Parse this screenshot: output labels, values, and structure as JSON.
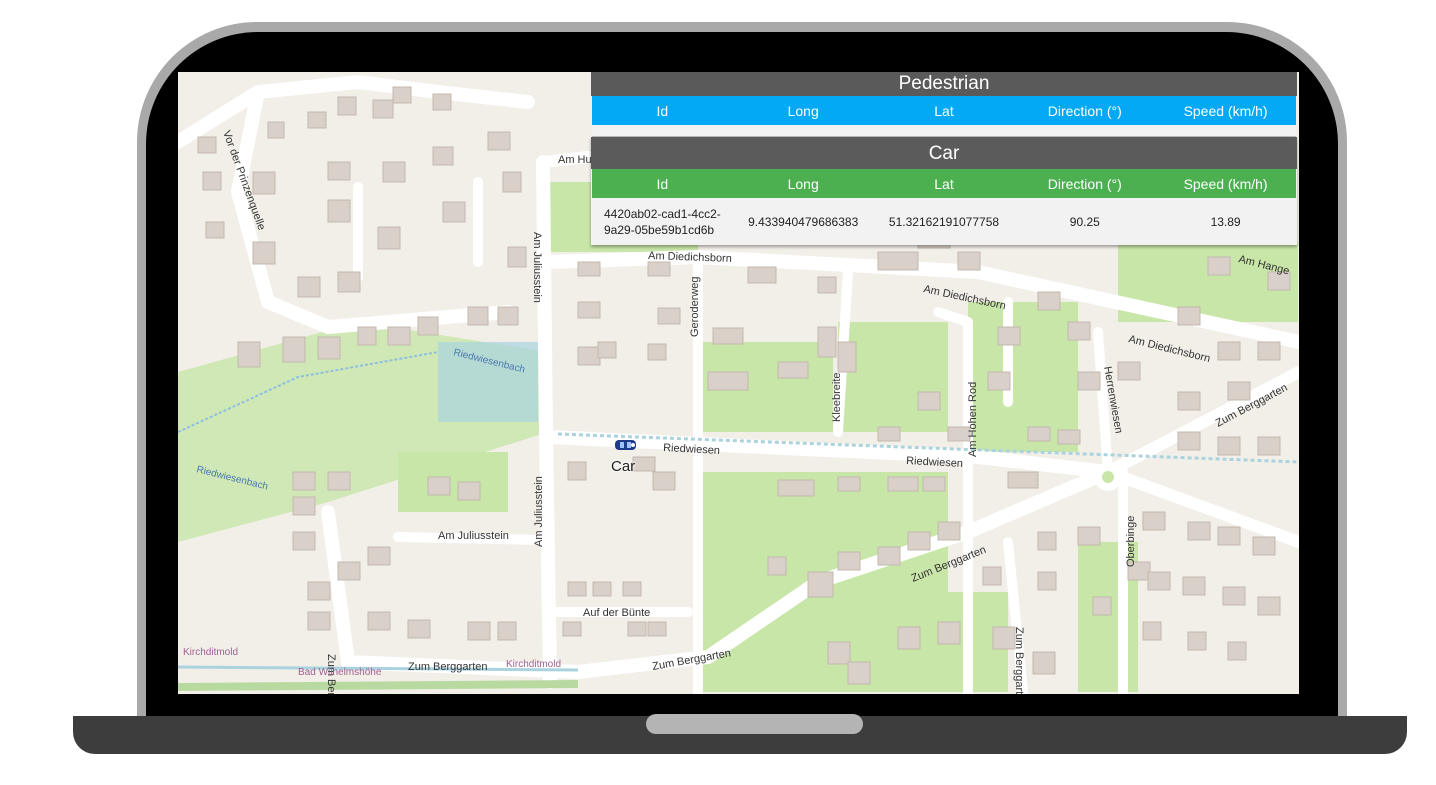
{
  "pedestrian": {
    "title": "Pedestrian",
    "columns": [
      "Id",
      "Long",
      "Lat",
      "Direction (°)",
      "Speed (km/h)"
    ],
    "rows": []
  },
  "car": {
    "title": "Car",
    "columns": [
      "Id",
      "Long",
      "Lat",
      "Direction (°)",
      "Speed (km/h)"
    ],
    "rows": [
      {
        "id": "4420ab02-cad1-4cc2-9a29-05be59b1cd6b",
        "long": "9.433940479686383",
        "lat": "51.32162191077758",
        "direction": "90.25",
        "speed": "13.89"
      }
    ]
  },
  "marker": {
    "label": "Car",
    "icon": "car-icon"
  },
  "map": {
    "streets": [
      "Am Hutekamp",
      "Am Diedichsborn",
      "Am Juliusstein",
      "Riedwiesen",
      "Vor der Prinzenquelle",
      "Geroderweg",
      "Kleebreite",
      "Am Hohen Rod",
      "Herrenwiesen",
      "Zum Berggarten",
      "Auf der Bünte",
      "Oberbinge",
      "Am Hange",
      "Riedwiesenbach",
      "Kirchditmold",
      "Bad Wilhelmshöhe"
    ],
    "colors": {
      "land": "#f2efe9",
      "green": "#c8e6a8",
      "road": "#ffffff",
      "building": "#d9d0c9",
      "water": "#aad3df",
      "pedestrian_header": "#03a9f4",
      "car_header": "#4caf50"
    }
  }
}
